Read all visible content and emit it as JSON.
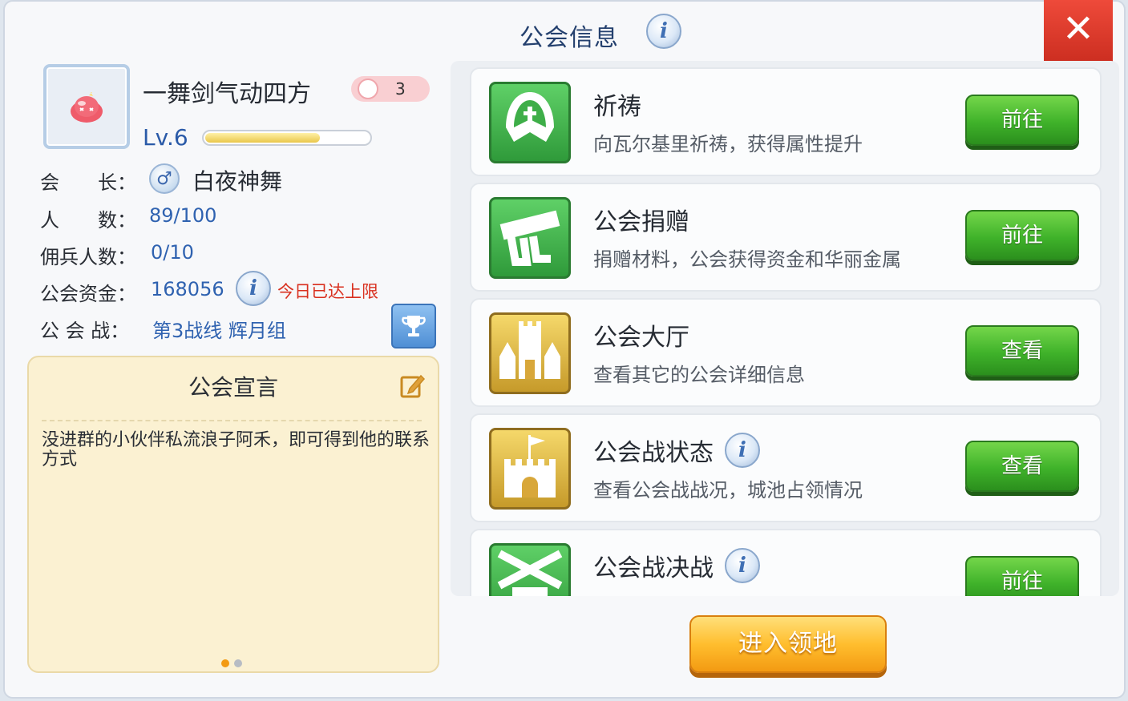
{
  "title": "公会信息",
  "close_label": "✕",
  "guild": {
    "name": "一舞剑气动四方",
    "badge_count": "3",
    "level": "Lv.6",
    "exp_progress": 0.7
  },
  "info_rows": {
    "leader_label": "会　　长：",
    "leader_gender": "♂",
    "leader_name": "白夜神舞",
    "members_label": "人　　数：",
    "members_value": "89/100",
    "mercs_label": "佣兵人数：",
    "mercs_value": "0/10",
    "funds_label": "公会资金：",
    "funds_value": "168056",
    "funds_note": "今日已达上限",
    "war_label": "公 会 战：",
    "war_value": "第3战线 辉月组"
  },
  "declaration": {
    "title": "公会宣言",
    "text": "没进群的小伙伴私流浪子阿禾，即可得到他的联系方式"
  },
  "features": [
    {
      "title": "祈祷",
      "desc": "向瓦尔基里祈祷，获得属性提升",
      "button": "前往",
      "icon": "prayer-icon",
      "has_info": false
    },
    {
      "title": "公会捐赠",
      "desc": "捐赠材料，公会获得资金和华丽金属",
      "button": "前往",
      "icon": "donate-icon",
      "has_info": false
    },
    {
      "title": "公会大厅",
      "desc": "查看其它的公会详细信息",
      "button": "查看",
      "icon": "castle-icon",
      "has_info": false
    },
    {
      "title": "公会战状态",
      "desc": "查看公会战战况，城池占领情况",
      "button": "查看",
      "icon": "flag-castle-icon",
      "has_info": true
    },
    {
      "title": "公会战决战",
      "desc": "",
      "button": "前往",
      "icon": "crossed-swords-icon",
      "has_info": true
    }
  ],
  "enter_button": "进入领地",
  "info_glyph": "i",
  "colors": {
    "accent_blue": "#2f62b0",
    "green_button": "#3fb22a",
    "orange_button": "#ffbe2e",
    "close_red": "#d83424",
    "warning_red": "#d9301f"
  }
}
